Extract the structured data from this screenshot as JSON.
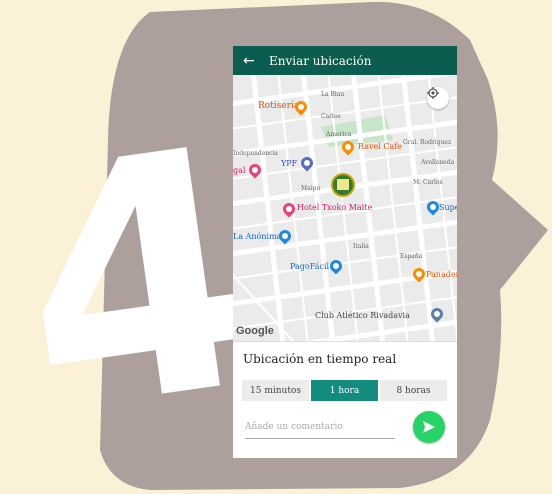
{
  "decoration": {
    "big_number": "4"
  },
  "header": {
    "title": "Enviar ubicación",
    "back_icon": "arrow-left-icon"
  },
  "map": {
    "attribution": "Google",
    "places": {
      "rotiseria": "Rotisería",
      "la_blan": "La Blan",
      "carlos": "Carlos",
      "america": "America",
      "ravel_cafe": "Ravel Cafe",
      "independencia": "Independencia",
      "gral_rodriguez": "Gral. Rodríguez",
      "gal": "gal",
      "ypf": "YPF",
      "avellaneda": "Avellaneda",
      "maipu": "Maipú",
      "m_carlos": "M. Carlos",
      "hotel": "Hotel Txoko Maite",
      "super": "Super",
      "la_anonima": "La Anónima",
      "italia": "Italia",
      "pagofacil": "PagoFácil",
      "espana": "España",
      "panader": "Panader",
      "club": "Club Atlético Rivadavia"
    }
  },
  "sheet": {
    "title": "Ubicación en tiempo real",
    "durations": [
      "15 minutos",
      "1 hora",
      "8 horas"
    ],
    "selected_index": 1,
    "comment_placeholder": "Añade un comentario"
  },
  "colors": {
    "appbar": "#0b5e4f",
    "accent": "#128c7e",
    "send": "#25d366",
    "background": "#fbf1d6",
    "frame": "#ad9f9b"
  }
}
